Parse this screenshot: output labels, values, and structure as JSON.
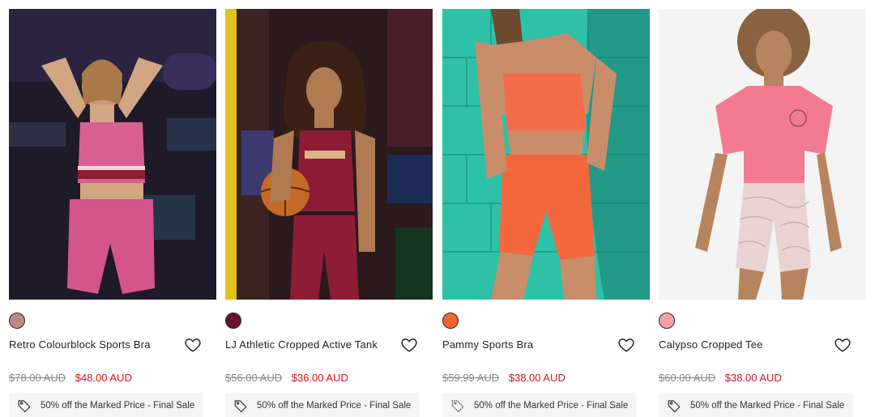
{
  "products": [
    {
      "name": "Retro Colourblock Sports Bra",
      "was_price": "$78.00 AUD",
      "sale_price": "$48.00 AUD",
      "promo": "50% off the Marked Price - Final Sale",
      "swatch_color": "#c08a80",
      "image_alt": "Model in pink Retro Colourblock Sports Bra and bike shorts"
    },
    {
      "name": "LJ Athletic Cropped Active Tank",
      "was_price": "$56.00 AUD",
      "sale_price": "$36.00 AUD",
      "promo": "50% off the Marked Price - Final Sale",
      "swatch_color": "#6b1030",
      "image_alt": "Model in burgundy LJ Athletic Cropped Active Tank holding a basketball"
    },
    {
      "name": "Pammy Sports Bra",
      "was_price": "$59.99 AUD",
      "sale_price": "$38.00 AUD",
      "promo": "50% off the Marked Price - Final Sale",
      "swatch_color": "#f2642e",
      "image_alt": "Model in coral Pammy Sports Bra and shorts against teal wall"
    },
    {
      "name": "Calypso Cropped Tee",
      "was_price": "$60.00 AUD",
      "sale_price": "$38.00 AUD",
      "promo": "50% off the Marked Price - Final Sale",
      "swatch_color": "#f4a0a6",
      "image_alt": "Model in pink Calypso Cropped Tee and patterned shorts"
    }
  ],
  "icons": {
    "wishlist": "heart-icon",
    "promo": "tag-icon"
  },
  "colors": {
    "sale_red": "#d0161b",
    "was_grey": "#8a8a8a",
    "promo_bg": "#f5f5f5"
  }
}
